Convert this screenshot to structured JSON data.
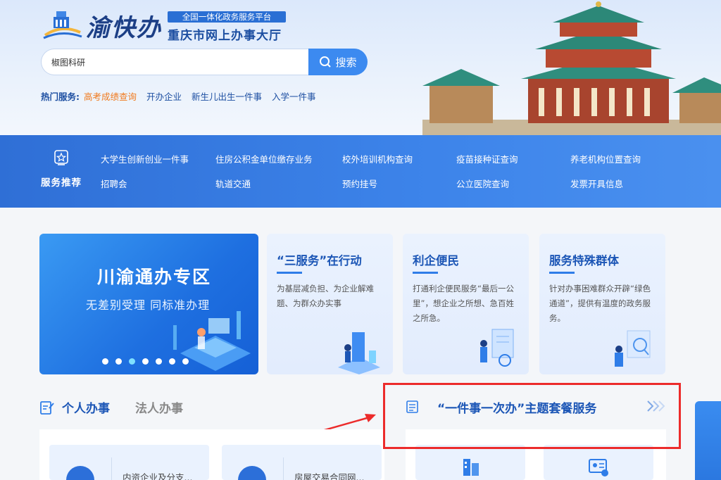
{
  "header": {
    "brand": "渝快办",
    "tagline": "全国一体化政务服务平台",
    "subtitle": "重庆市网上办事大厅"
  },
  "search": {
    "value": "椒图科研",
    "button_label": "搜索"
  },
  "hot_services": {
    "label": "热门服务:",
    "items": [
      "高考成绩查询",
      "开办企业",
      "新生儿出生一件事",
      "入学一件事"
    ]
  },
  "service_band": {
    "title": "服务推荐",
    "row1": [
      "大学生创新创业一件事",
      "住房公积金单位缴存业务",
      "校外培训机构查询",
      "疫苗接种证查询",
      "养老机构位置查询"
    ],
    "row2": [
      "招聘会",
      "轨道交通",
      "预约挂号",
      "公立医院查询",
      "发票开具信息"
    ]
  },
  "carousel": {
    "title": "川渝通办专区",
    "subtitle": "无差别受理  同标准办理",
    "slides": 7,
    "active_slide": 3
  },
  "cards": [
    {
      "title": "“三服务”在行动",
      "desc": "为基层减负担、为企业解难题、为群众办实事"
    },
    {
      "title": "利企便民",
      "desc": "打通利企便民服务“最后一公里”，想企业之所想、急百姓之所急。"
    },
    {
      "title": "服务特殊群体",
      "desc": "针对办事困难群众开辟“绿色通道”，提供有温度的政务服务。"
    }
  ],
  "tabs": {
    "personal": "个人办事",
    "legal": "法人办事"
  },
  "theme": {
    "title": "“一件事一次办”主题套餐服务"
  },
  "items": [
    {
      "text": "内资企业及分支..."
    },
    {
      "text": "房屋交易合同网..."
    }
  ],
  "colors": {
    "brand_blue": "#1c56b6",
    "accent_orange": "#f07a1e",
    "highlight_red": "#ec2b2b"
  }
}
